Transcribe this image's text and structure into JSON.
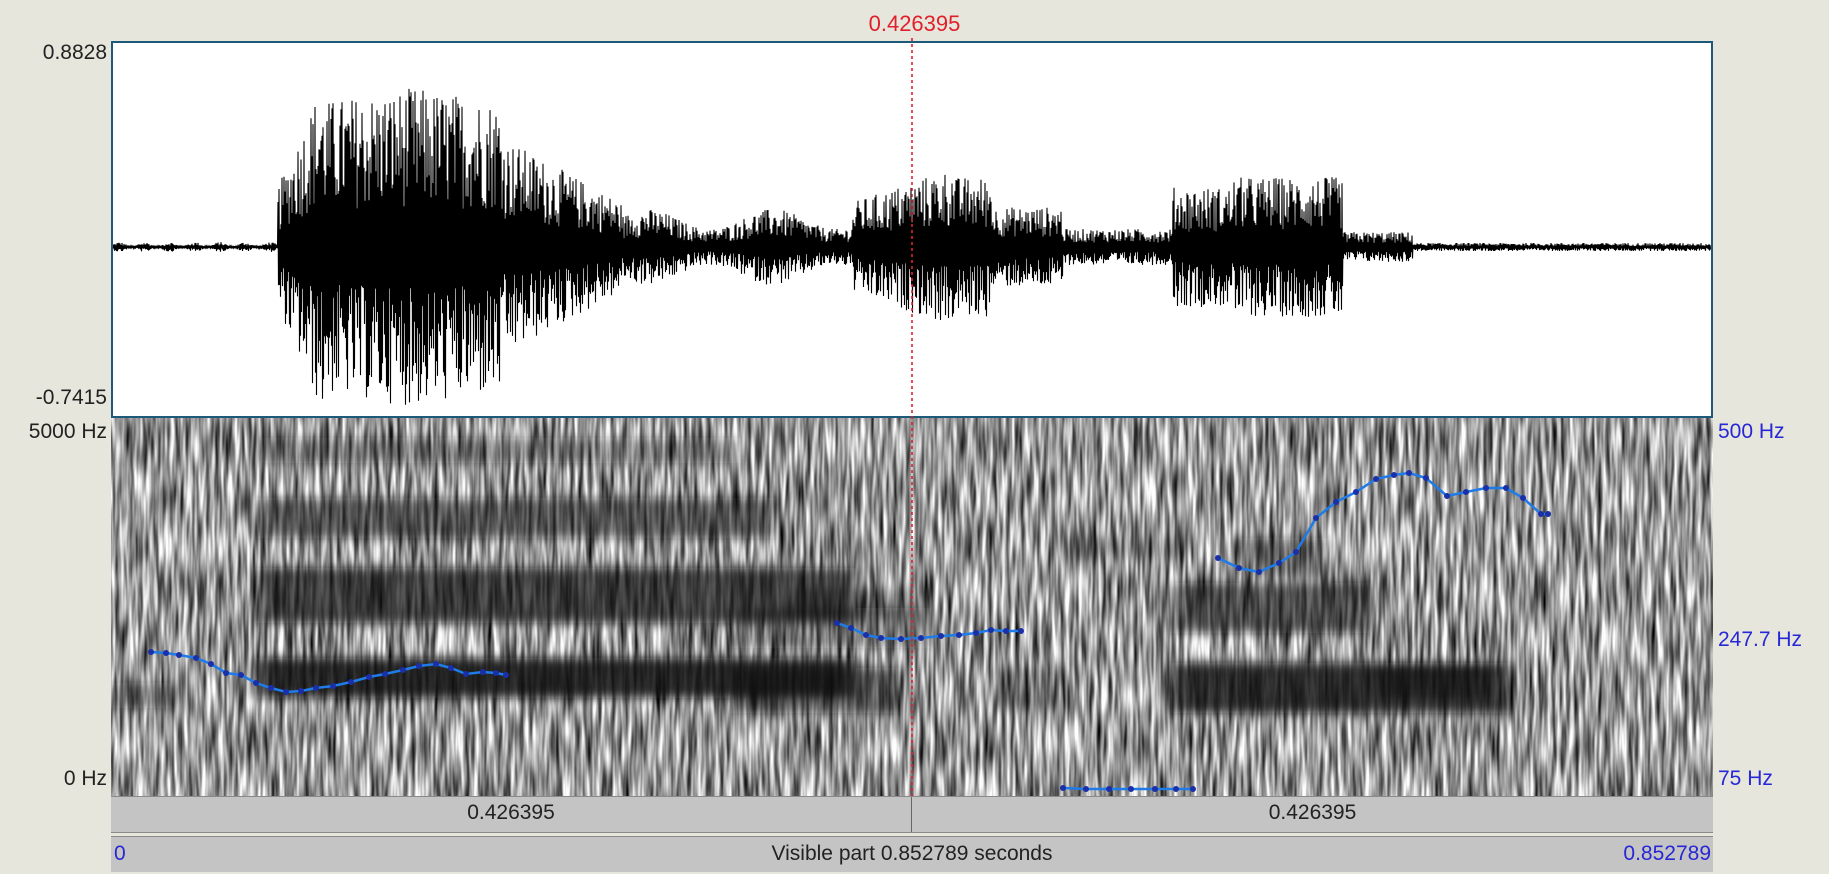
{
  "cursor": {
    "time_label": "0.426395",
    "time_s": 0.426395
  },
  "waveform": {
    "y_max_label": "0.8828",
    "y_min_label": "-0.7415"
  },
  "spectrogram": {
    "freq_top_label": "5000 Hz",
    "freq_bottom_label": "0 Hz",
    "pitch_top_label": "500 Hz",
    "pitch_mid_label": "247.7 Hz",
    "pitch_bottom_label": "75 Hz"
  },
  "time_bar": {
    "left_segment_label": "0.426395",
    "right_segment_label": "0.426395"
  },
  "visible_bar": {
    "start_label": "0",
    "center_label": "Visible part 0.852789 seconds",
    "end_label": "0.852789"
  },
  "colors": {
    "cursor": "#e0202a",
    "pitch": "#1e7be8",
    "pitch_points": "#1a2fa8",
    "axis_blue": "#2727d6"
  },
  "audio": {
    "duration_s": 0.852789
  }
}
